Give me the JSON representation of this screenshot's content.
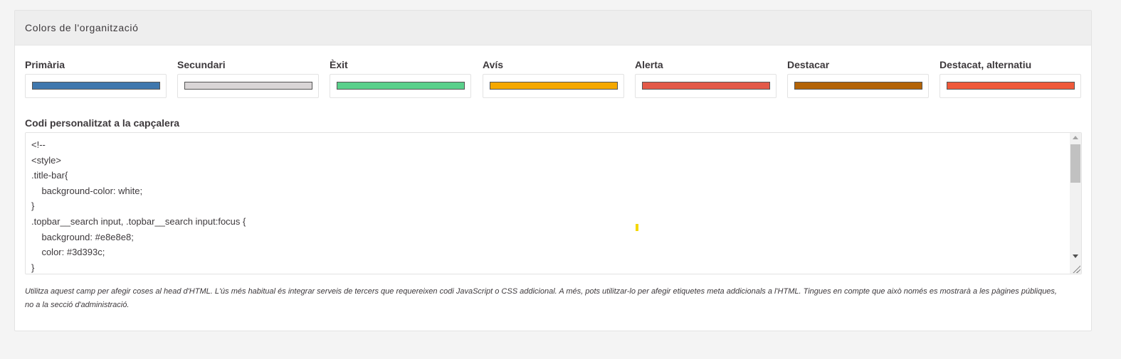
{
  "section": {
    "title": "Colors de l'organització"
  },
  "colors": [
    {
      "label": "Primària",
      "hex": "#3f77ad",
      "icon": "color-swatch"
    },
    {
      "label": "Secundari",
      "hex": "#d9d5d6",
      "icon": "color-swatch"
    },
    {
      "label": "Èxit",
      "hex": "#5ad08b",
      "icon": "color-swatch"
    },
    {
      "label": "Avís",
      "hex": "#f5a800",
      "icon": "color-swatch"
    },
    {
      "label": "Alerta",
      "hex": "#e35948",
      "icon": "color-swatch"
    },
    {
      "label": "Destacar",
      "hex": "#b36307",
      "icon": "color-swatch"
    },
    {
      "label": "Destacat, alternatiu",
      "hex": "#ef593a",
      "icon": "color-swatch"
    }
  ],
  "header_code": {
    "label": "Codi personalitzat a la capçalera",
    "lines": [
      "<!--",
      "<style>",
      ".title-bar{",
      "    background-color: white;",
      "}",
      ".topbar__search input, .topbar__search input:focus {",
      "    background: #e8e8e8;",
      "    color: #3d393c;",
      "}"
    ],
    "help": "Utilitza aquest camp per afegir coses al head d'HTML. L'ús més habitual és integrar serveis de tercers que requereixen codi JavaScript o CSS addicional. A més, pots utilitzar-lo per afegir etiquetes meta addicionals a l'HTML. Tingues en compte que això només es mostrarà a les pàgines públiques, no a la secció d'administració."
  }
}
